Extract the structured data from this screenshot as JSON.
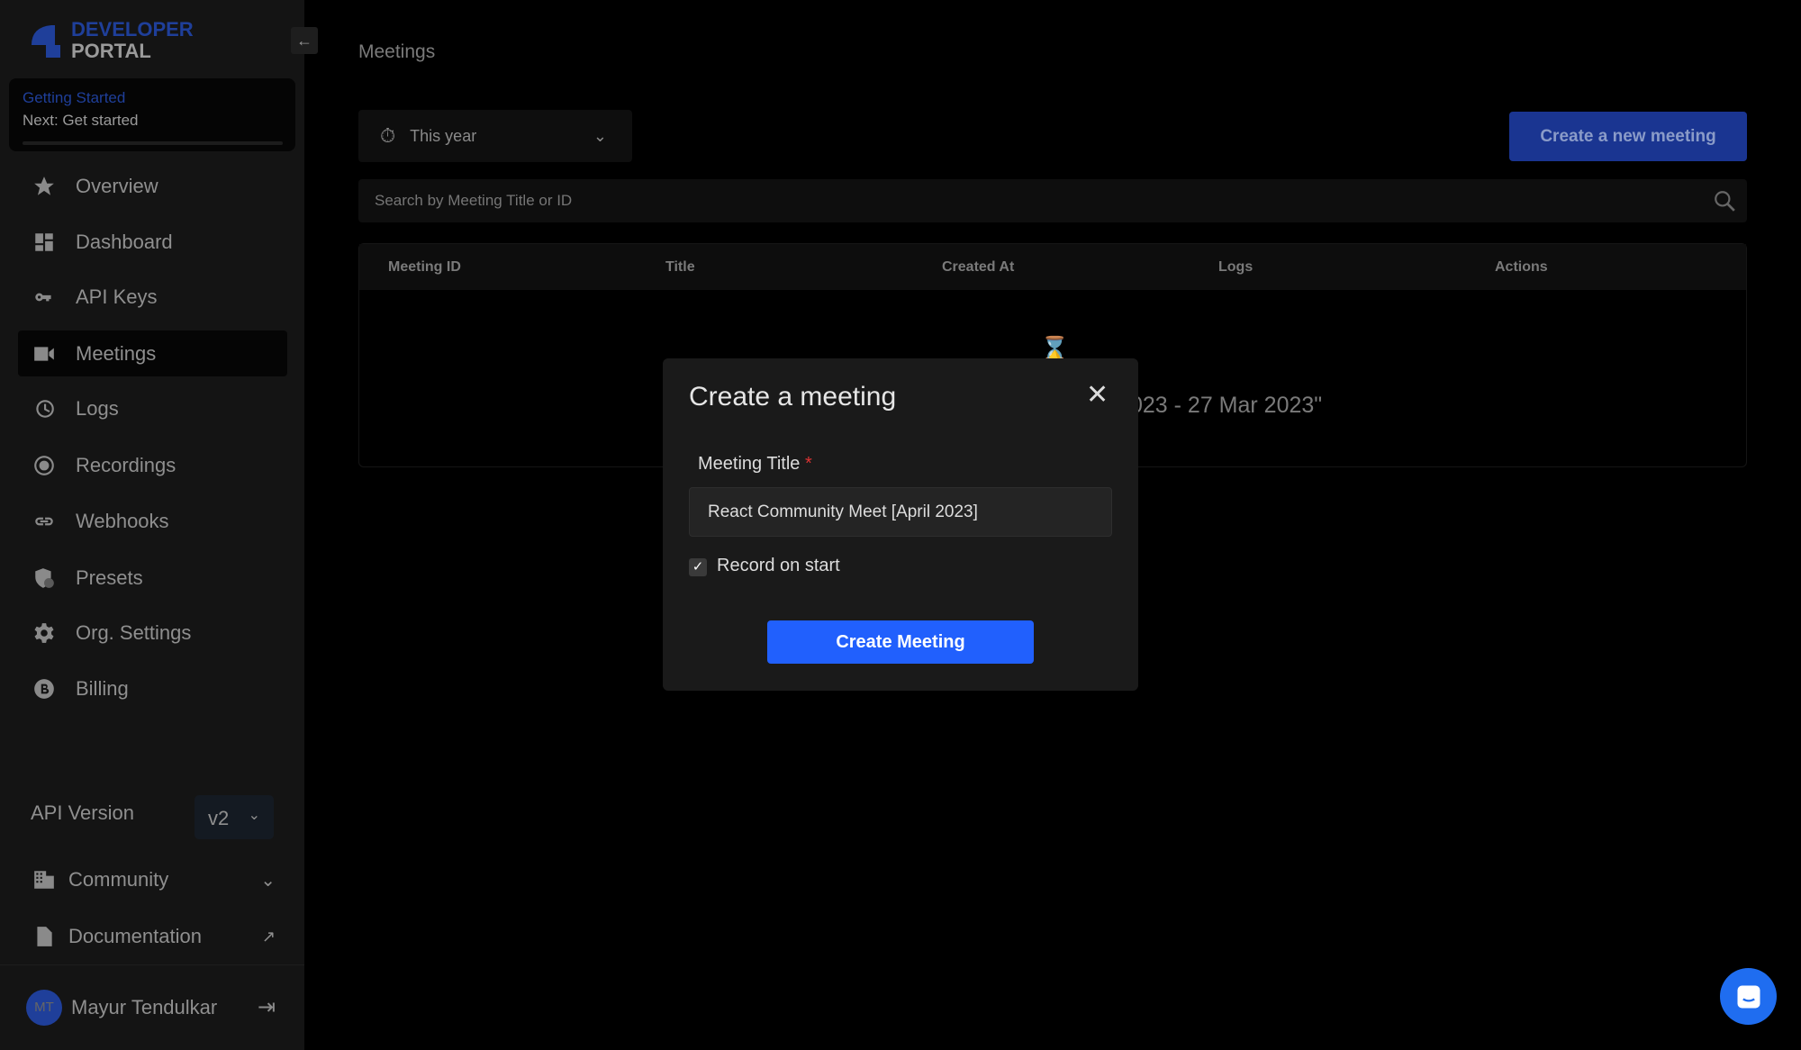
{
  "brand": {
    "line1": "DEVELOPER",
    "line2": "PORTAL"
  },
  "getting_started": {
    "title": "Getting Started",
    "next": "Next: Get started",
    "progress": 0
  },
  "sidebar": {
    "items": [
      {
        "label": "Overview",
        "icon": "star-icon"
      },
      {
        "label": "Dashboard",
        "icon": "dashboard-icon"
      },
      {
        "label": "API Keys",
        "icon": "key-icon"
      },
      {
        "label": "Meetings",
        "icon": "video-icon",
        "active": true
      },
      {
        "label": "Logs",
        "icon": "history-icon"
      },
      {
        "label": "Recordings",
        "icon": "record-icon"
      },
      {
        "label": "Webhooks",
        "icon": "link-icon"
      },
      {
        "label": "Presets",
        "icon": "shield-icon"
      },
      {
        "label": "Org. Settings",
        "icon": "gear-icon"
      },
      {
        "label": "Billing",
        "icon": "bitcoin-icon"
      }
    ],
    "api_version_label": "API Version",
    "api_version": "v2",
    "community": "Community",
    "documentation": "Documentation",
    "user": {
      "initials": "MT",
      "name": "Mayur Tendulkar"
    }
  },
  "main": {
    "breadcrumb": "Meetings",
    "filter": "This year",
    "create_button": "Create a new meeting",
    "search_placeholder": "Search by Meeting Title or ID",
    "columns": [
      "Meeting ID",
      "Title",
      "Created At",
      "Logs",
      "Actions"
    ],
    "empty_text": "023 - 27 Mar 2023\""
  },
  "modal": {
    "title": "Create a meeting",
    "label": "Meeting Title",
    "required": "*",
    "value": "React Community Meet [April 2023]",
    "checkbox_label": "Record on start",
    "checked": true,
    "submit": "Create Meeting"
  },
  "colors": {
    "accent": "#2160fd",
    "brand": "#1f3f9a"
  }
}
